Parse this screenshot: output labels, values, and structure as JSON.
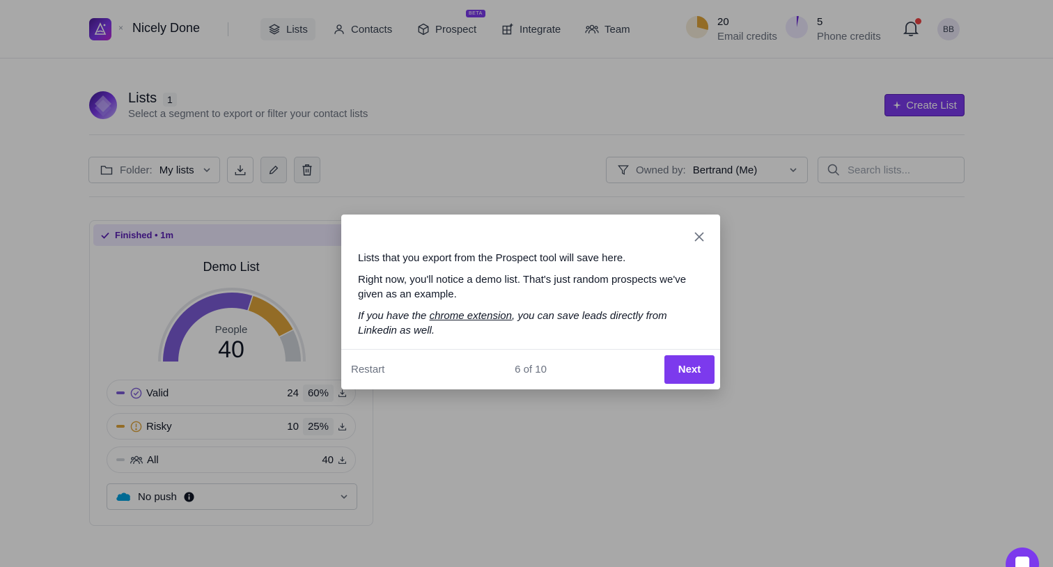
{
  "header": {
    "brand": "Nicely Done",
    "brand_separator": "×",
    "nav": [
      {
        "label": "Lists",
        "icon": "layers-icon",
        "active": true
      },
      {
        "label": "Contacts",
        "icon": "user-icon"
      },
      {
        "label": "Prospect",
        "icon": "cube-icon",
        "badge": "BETA"
      },
      {
        "label": "Integrate",
        "icon": "grid-plus-icon"
      },
      {
        "label": "Team",
        "icon": "team-icon"
      }
    ],
    "credits": [
      {
        "value": "20",
        "label": "Email credits",
        "color": "#e0a53b"
      },
      {
        "value": "5",
        "label": "Phone credits",
        "color": "#6d28d9"
      }
    ],
    "avatar_initials": "BB"
  },
  "page": {
    "title": "Lists",
    "count": "1",
    "subtitle": "Select a segment to export or filter your contact lists",
    "create_label": "Create List"
  },
  "toolbar": {
    "folder_key": "Folder:",
    "folder_value": "My lists",
    "owner_key": "Owned by:",
    "owner_value": "Bertrand (Me)",
    "search_placeholder": "Search lists..."
  },
  "card": {
    "status": "Finished • 1m",
    "title": "Demo List",
    "gauge_label": "People",
    "gauge_value": "40",
    "gauge_segments": [
      {
        "name": "Valid",
        "fraction": 0.6,
        "color": "#7c5cd6"
      },
      {
        "name": "Risky",
        "fraction": 0.25,
        "color": "#e0a53b"
      },
      {
        "name": "Rest",
        "fraction": 0.15,
        "color": "#d1d5db"
      }
    ],
    "stats": [
      {
        "name": "Valid",
        "count": "24",
        "pct": "60%",
        "color": "#7c5cd6"
      },
      {
        "name": "Risky",
        "count": "10",
        "pct": "25%",
        "color": "#e0a53b"
      },
      {
        "name": "All",
        "count": "40",
        "color": "#d1d5db"
      }
    ],
    "push_label": "No push"
  },
  "modal": {
    "p1": "Lists that you export from the Prospect tool will save here.",
    "p2": "Right now, you'll notice a demo list. That's just random prospects we've given as an example.",
    "p3_before": "If you have the ",
    "p3_link": "chrome extension",
    "p3_after": ", you can save leads directly from Linkedin as well.",
    "restart": "Restart",
    "step": "6 of 10",
    "next": "Next"
  }
}
